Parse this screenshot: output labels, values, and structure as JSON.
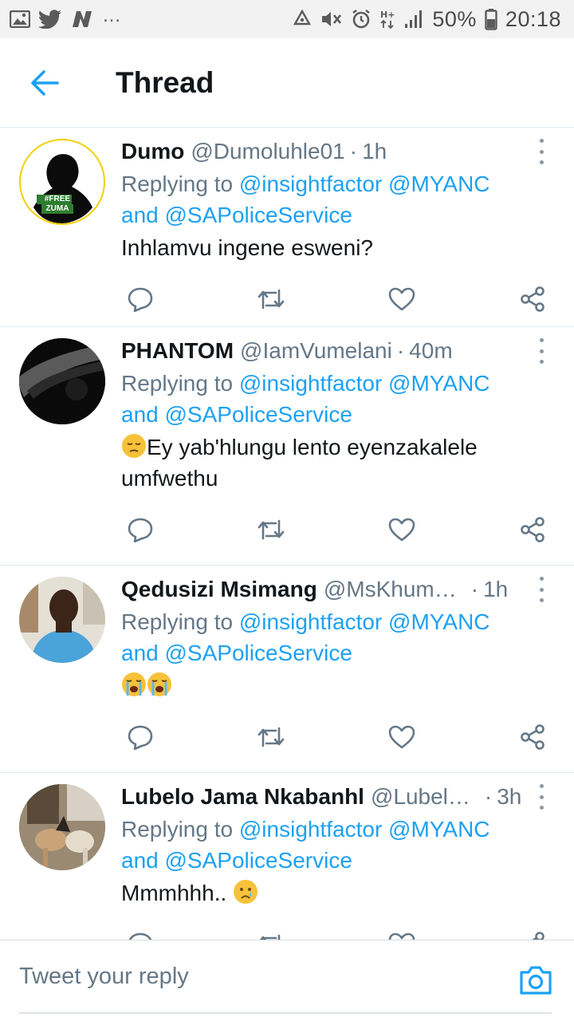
{
  "status_bar": {
    "battery": "50%",
    "time": "20:18",
    "network": "H+",
    "overflow": "…"
  },
  "header": {
    "title": "Thread",
    "back_icon": "arrow-left-icon"
  },
  "colors": {
    "accent": "#1da1f2",
    "text": "#14171a",
    "secondary": "#657786",
    "divider": "#e1e8ed"
  },
  "tweets": [
    {
      "name": "Dumo",
      "handle": "@Dumoluhle01",
      "sep": "·",
      "time": "1h",
      "replying_prefix": "Replying to",
      "mention_1": "@insightfactor",
      "mention_2": "@MYANC",
      "and": "and",
      "mention_3": "@SAPoliceService",
      "text": "Inhlamvu ingene esweni?",
      "avatar_text": "#FREE ZUMA"
    },
    {
      "name": "PHANTOM",
      "handle": "@IamVumelani",
      "sep": "·",
      "time": "40m",
      "replying_prefix": "Replying to",
      "mention_1": "@insightfactor",
      "mention_2": "@MYANC",
      "and": "and",
      "mention_3": "@SAPoliceService",
      "text": "Ey yab'hlungu lento eyenzakalele umfwethu",
      "emoji": "pensive-face"
    },
    {
      "name": "Qedusizi Msimang",
      "handle": "@MsKhum…",
      "sep": "·",
      "time": "1h",
      "replying_prefix": "Replying to",
      "mention_1": "@insightfactor",
      "mention_2": "@MYANC",
      "and": "and",
      "mention_3": "@SAPoliceService",
      "text": "",
      "emoji": "loudly-crying-face"
    },
    {
      "name": "Lubelo Jama Nkabanhl",
      "handle": "@Lubel…",
      "sep": "·",
      "time": "3h",
      "replying_prefix": "Replying to",
      "mention_1": "@insightfactor",
      "mention_2": "@MYANC",
      "and": "and",
      "mention_3": "@SAPoliceService",
      "text": "Mmmhhh..",
      "emoji": "crying-face"
    }
  ],
  "actions": [
    "reply-icon",
    "retweet-icon",
    "like-icon",
    "share-icon"
  ],
  "reply_bar": {
    "placeholder": "Tweet your reply",
    "camera_icon": "camera-icon"
  }
}
